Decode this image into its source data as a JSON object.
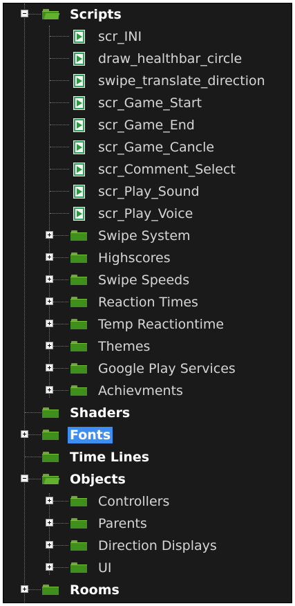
{
  "tree": {
    "scripts_folder": {
      "label": "Scripts",
      "files": [
        "scr_INI",
        "draw_healthbar_circle",
        "swipe_translate_direction",
        "scr_Game_Start",
        "scr_Game_End",
        "scr_Game_Cancle",
        "scr_Comment_Select",
        "scr_Play_Sound",
        "scr_Play_Voice"
      ],
      "subfolders": [
        "Swipe System",
        "Highscores",
        "Swipe Speeds",
        "Reaction Times",
        "Temp Reactiontime",
        "Themes",
        "Google Play Services",
        "Achievments"
      ]
    },
    "shaders_label": "Shaders",
    "fonts_label": "Fonts",
    "timelines_label": "Time Lines",
    "objects_folder": {
      "label": "Objects",
      "subfolders": [
        "Controllers",
        "Parents",
        "Direction Displays",
        "UI"
      ]
    },
    "rooms_label": "Rooms"
  },
  "colors": {
    "background": "#1a1a1a",
    "folder_green": "#3e8f1c",
    "selection_blue": "#3c8ef0",
    "text": "#d6d6d6"
  }
}
